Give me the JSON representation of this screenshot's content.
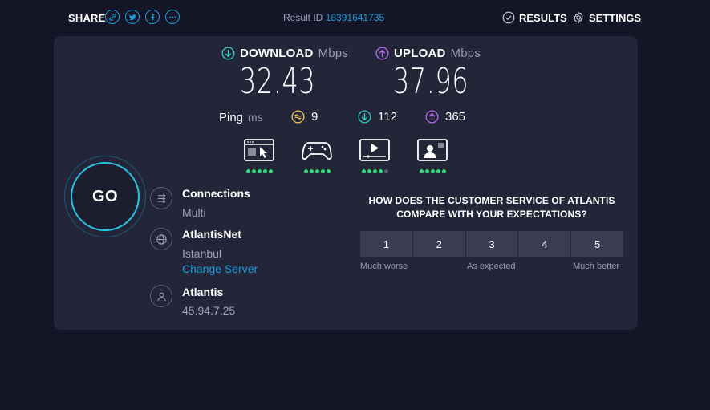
{
  "header": {
    "share_label": "SHARE",
    "share_buttons": [
      {
        "icon": "link-icon"
      },
      {
        "icon": "twitter-icon"
      },
      {
        "icon": "facebook-icon"
      },
      {
        "icon": "more-icon"
      }
    ],
    "result_id_label": "Result ID",
    "result_id": "18391641735",
    "results_label": "RESULTS",
    "settings_label": "SETTINGS"
  },
  "download": {
    "label": "DOWNLOAD",
    "unit": "Mbps",
    "value": "32.43",
    "color": "#2fd3c5"
  },
  "upload": {
    "label": "UPLOAD",
    "unit": "Mbps",
    "value": "37.96",
    "color": "#b66cf0"
  },
  "ping": {
    "label": "Ping",
    "unit": "ms",
    "idle": "9",
    "download": "112",
    "upload": "365",
    "idle_color": "#f2c94c"
  },
  "quality": [
    {
      "icon": "web-browsing-icon",
      "rating": 5
    },
    {
      "icon": "gaming-icon",
      "rating": 5
    },
    {
      "icon": "video-streaming-icon",
      "rating": 4
    },
    {
      "icon": "video-call-icon",
      "rating": 5
    }
  ],
  "go_label": "GO",
  "connections": {
    "title": "Connections",
    "value": "Multi"
  },
  "isp": {
    "title": "AtlantisNet",
    "location": "Istanbul",
    "change_server": "Change Server"
  },
  "host": {
    "title": "Atlantis",
    "ip": "45.94.7.25"
  },
  "survey": {
    "question": "HOW DOES THE CUSTOMER SERVICE OF ATLANTIS COMPARE WITH YOUR EXPECTATIONS?",
    "options": [
      "1",
      "2",
      "3",
      "4",
      "5"
    ],
    "low_label": "Much worse",
    "mid_label": "As expected",
    "high_label": "Much better"
  },
  "colors": {
    "accent": "#1a9bd7",
    "background": "#141526",
    "panel": "#232538",
    "dot_on": "#37d67a"
  }
}
